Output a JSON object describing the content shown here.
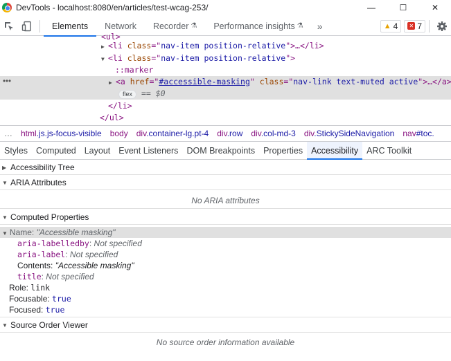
{
  "window": {
    "title": "DevTools - localhost:8080/en/articles/test-wcag-253/",
    "minimize": "—",
    "maximize": "☐",
    "close": "✕"
  },
  "toolbar": {
    "tabs": [
      {
        "label": "Elements",
        "active": true
      },
      {
        "label": "Network"
      },
      {
        "label": "Recorder"
      },
      {
        "label": "Performance insights"
      }
    ],
    "more": "»",
    "warnings": "4",
    "errors": "7"
  },
  "dom": {
    "line_top": "<ul>",
    "line1": {
      "tag_open": "<li ",
      "attr": "class",
      "eq": "=\"",
      "val": "nav-item position-relative",
      "close": "\">…</li>"
    },
    "line2": {
      "tag_open": "<li ",
      "attr": "class",
      "eq": "=\"",
      "val": "nav-item position-relative",
      "close": "\">"
    },
    "marker": "::marker",
    "line4": {
      "tag_open": "<a ",
      "attr1": "href",
      "val1": "#accessible-masking",
      "attr2": "class",
      "val2": "nav-link text-muted active",
      "close": "\">…</a>"
    },
    "flex": "flex",
    "eq0": "== $0",
    "li_close": "</li>",
    "ul_close": "</ul>"
  },
  "breadcrumbs": {
    "dots": "…",
    "items": [
      {
        "name": "html",
        "cls": ".js.js-focus-visible"
      },
      {
        "name": "body",
        "cls": ""
      },
      {
        "name": "div",
        "cls": ".container-lg.pt-4"
      },
      {
        "name": "div",
        "cls": ".row"
      },
      {
        "name": "div",
        "cls": ".col-md-3"
      },
      {
        "name": "div",
        "cls": ".StickySideNavigation"
      },
      {
        "name": "nav",
        "cls": "#toc."
      }
    ]
  },
  "subtabs": [
    {
      "label": "Styles"
    },
    {
      "label": "Computed"
    },
    {
      "label": "Layout"
    },
    {
      "label": "Event Listeners"
    },
    {
      "label": "DOM Breakpoints"
    },
    {
      "label": "Properties"
    },
    {
      "label": "Accessibility",
      "active": true
    },
    {
      "label": "ARC Toolkit"
    }
  ],
  "accessibility": {
    "tree_label": "Accessibility Tree",
    "aria_label": "ARIA Attributes",
    "no_aria": "No ARIA attributes",
    "computed_label": "Computed Properties",
    "name_key": "Name: ",
    "name_val": "\"Accessible masking\"",
    "labelledby_key": "aria-labelledby",
    "labelledby_val": "Not specified",
    "label_key": "aria-label",
    "label_val": "Not specified",
    "contents_key": "Contents: ",
    "contents_val": "\"Accessible masking\"",
    "title_key": "title",
    "title_val": "Not specified",
    "role_key": "Role: ",
    "role_val": "link",
    "focusable_key": "Focusable: ",
    "focusable_val": "true",
    "focused_key": "Focused: ",
    "focused_val": "true",
    "source_label": "Source Order Viewer",
    "no_source": "No source order information available"
  }
}
